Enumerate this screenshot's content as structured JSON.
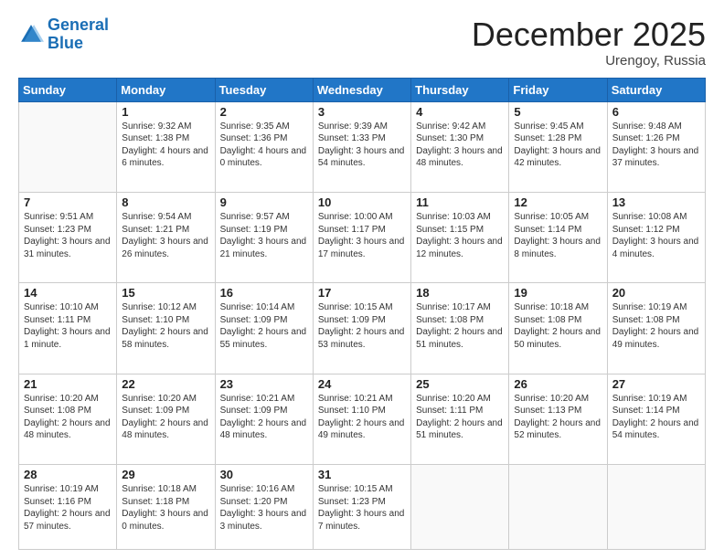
{
  "logo": {
    "line1": "General",
    "line2": "Blue"
  },
  "title": "December 2025",
  "location": "Urengoy, Russia",
  "days_of_week": [
    "Sunday",
    "Monday",
    "Tuesday",
    "Wednesday",
    "Thursday",
    "Friday",
    "Saturday"
  ],
  "weeks": [
    [
      null,
      {
        "day": 1,
        "sunrise": "9:32 AM",
        "sunset": "1:38 PM",
        "daylight": "4 hours and 6 minutes."
      },
      {
        "day": 2,
        "sunrise": "9:35 AM",
        "sunset": "1:36 PM",
        "daylight": "4 hours and 0 minutes."
      },
      {
        "day": 3,
        "sunrise": "9:39 AM",
        "sunset": "1:33 PM",
        "daylight": "3 hours and 54 minutes."
      },
      {
        "day": 4,
        "sunrise": "9:42 AM",
        "sunset": "1:30 PM",
        "daylight": "3 hours and 48 minutes."
      },
      {
        "day": 5,
        "sunrise": "9:45 AM",
        "sunset": "1:28 PM",
        "daylight": "3 hours and 42 minutes."
      },
      {
        "day": 6,
        "sunrise": "9:48 AM",
        "sunset": "1:26 PM",
        "daylight": "3 hours and 37 minutes."
      }
    ],
    [
      {
        "day": 7,
        "sunrise": "9:51 AM",
        "sunset": "1:23 PM",
        "daylight": "3 hours and 31 minutes."
      },
      {
        "day": 8,
        "sunrise": "9:54 AM",
        "sunset": "1:21 PM",
        "daylight": "3 hours and 26 minutes."
      },
      {
        "day": 9,
        "sunrise": "9:57 AM",
        "sunset": "1:19 PM",
        "daylight": "3 hours and 21 minutes."
      },
      {
        "day": 10,
        "sunrise": "10:00 AM",
        "sunset": "1:17 PM",
        "daylight": "3 hours and 17 minutes."
      },
      {
        "day": 11,
        "sunrise": "10:03 AM",
        "sunset": "1:15 PM",
        "daylight": "3 hours and 12 minutes."
      },
      {
        "day": 12,
        "sunrise": "10:05 AM",
        "sunset": "1:14 PM",
        "daylight": "3 hours and 8 minutes."
      },
      {
        "day": 13,
        "sunrise": "10:08 AM",
        "sunset": "1:12 PM",
        "daylight": "3 hours and 4 minutes."
      }
    ],
    [
      {
        "day": 14,
        "sunrise": "10:10 AM",
        "sunset": "1:11 PM",
        "daylight": "3 hours and 1 minute."
      },
      {
        "day": 15,
        "sunrise": "10:12 AM",
        "sunset": "1:10 PM",
        "daylight": "2 hours and 58 minutes."
      },
      {
        "day": 16,
        "sunrise": "10:14 AM",
        "sunset": "1:09 PM",
        "daylight": "2 hours and 55 minutes."
      },
      {
        "day": 17,
        "sunrise": "10:15 AM",
        "sunset": "1:09 PM",
        "daylight": "2 hours and 53 minutes."
      },
      {
        "day": 18,
        "sunrise": "10:17 AM",
        "sunset": "1:08 PM",
        "daylight": "2 hours and 51 minutes."
      },
      {
        "day": 19,
        "sunrise": "10:18 AM",
        "sunset": "1:08 PM",
        "daylight": "2 hours and 50 minutes."
      },
      {
        "day": 20,
        "sunrise": "10:19 AM",
        "sunset": "1:08 PM",
        "daylight": "2 hours and 49 minutes."
      }
    ],
    [
      {
        "day": 21,
        "sunrise": "10:20 AM",
        "sunset": "1:08 PM",
        "daylight": "2 hours and 48 minutes."
      },
      {
        "day": 22,
        "sunrise": "10:20 AM",
        "sunset": "1:09 PM",
        "daylight": "2 hours and 48 minutes."
      },
      {
        "day": 23,
        "sunrise": "10:21 AM",
        "sunset": "1:09 PM",
        "daylight": "2 hours and 48 minutes."
      },
      {
        "day": 24,
        "sunrise": "10:21 AM",
        "sunset": "1:10 PM",
        "daylight": "2 hours and 49 minutes."
      },
      {
        "day": 25,
        "sunrise": "10:20 AM",
        "sunset": "1:11 PM",
        "daylight": "2 hours and 51 minutes."
      },
      {
        "day": 26,
        "sunrise": "10:20 AM",
        "sunset": "1:13 PM",
        "daylight": "2 hours and 52 minutes."
      },
      {
        "day": 27,
        "sunrise": "10:19 AM",
        "sunset": "1:14 PM",
        "daylight": "2 hours and 54 minutes."
      }
    ],
    [
      {
        "day": 28,
        "sunrise": "10:19 AM",
        "sunset": "1:16 PM",
        "daylight": "2 hours and 57 minutes."
      },
      {
        "day": 29,
        "sunrise": "10:18 AM",
        "sunset": "1:18 PM",
        "daylight": "3 hours and 0 minutes."
      },
      {
        "day": 30,
        "sunrise": "10:16 AM",
        "sunset": "1:20 PM",
        "daylight": "3 hours and 3 minutes."
      },
      {
        "day": 31,
        "sunrise": "10:15 AM",
        "sunset": "1:23 PM",
        "daylight": "3 hours and 7 minutes."
      },
      null,
      null,
      null
    ]
  ]
}
